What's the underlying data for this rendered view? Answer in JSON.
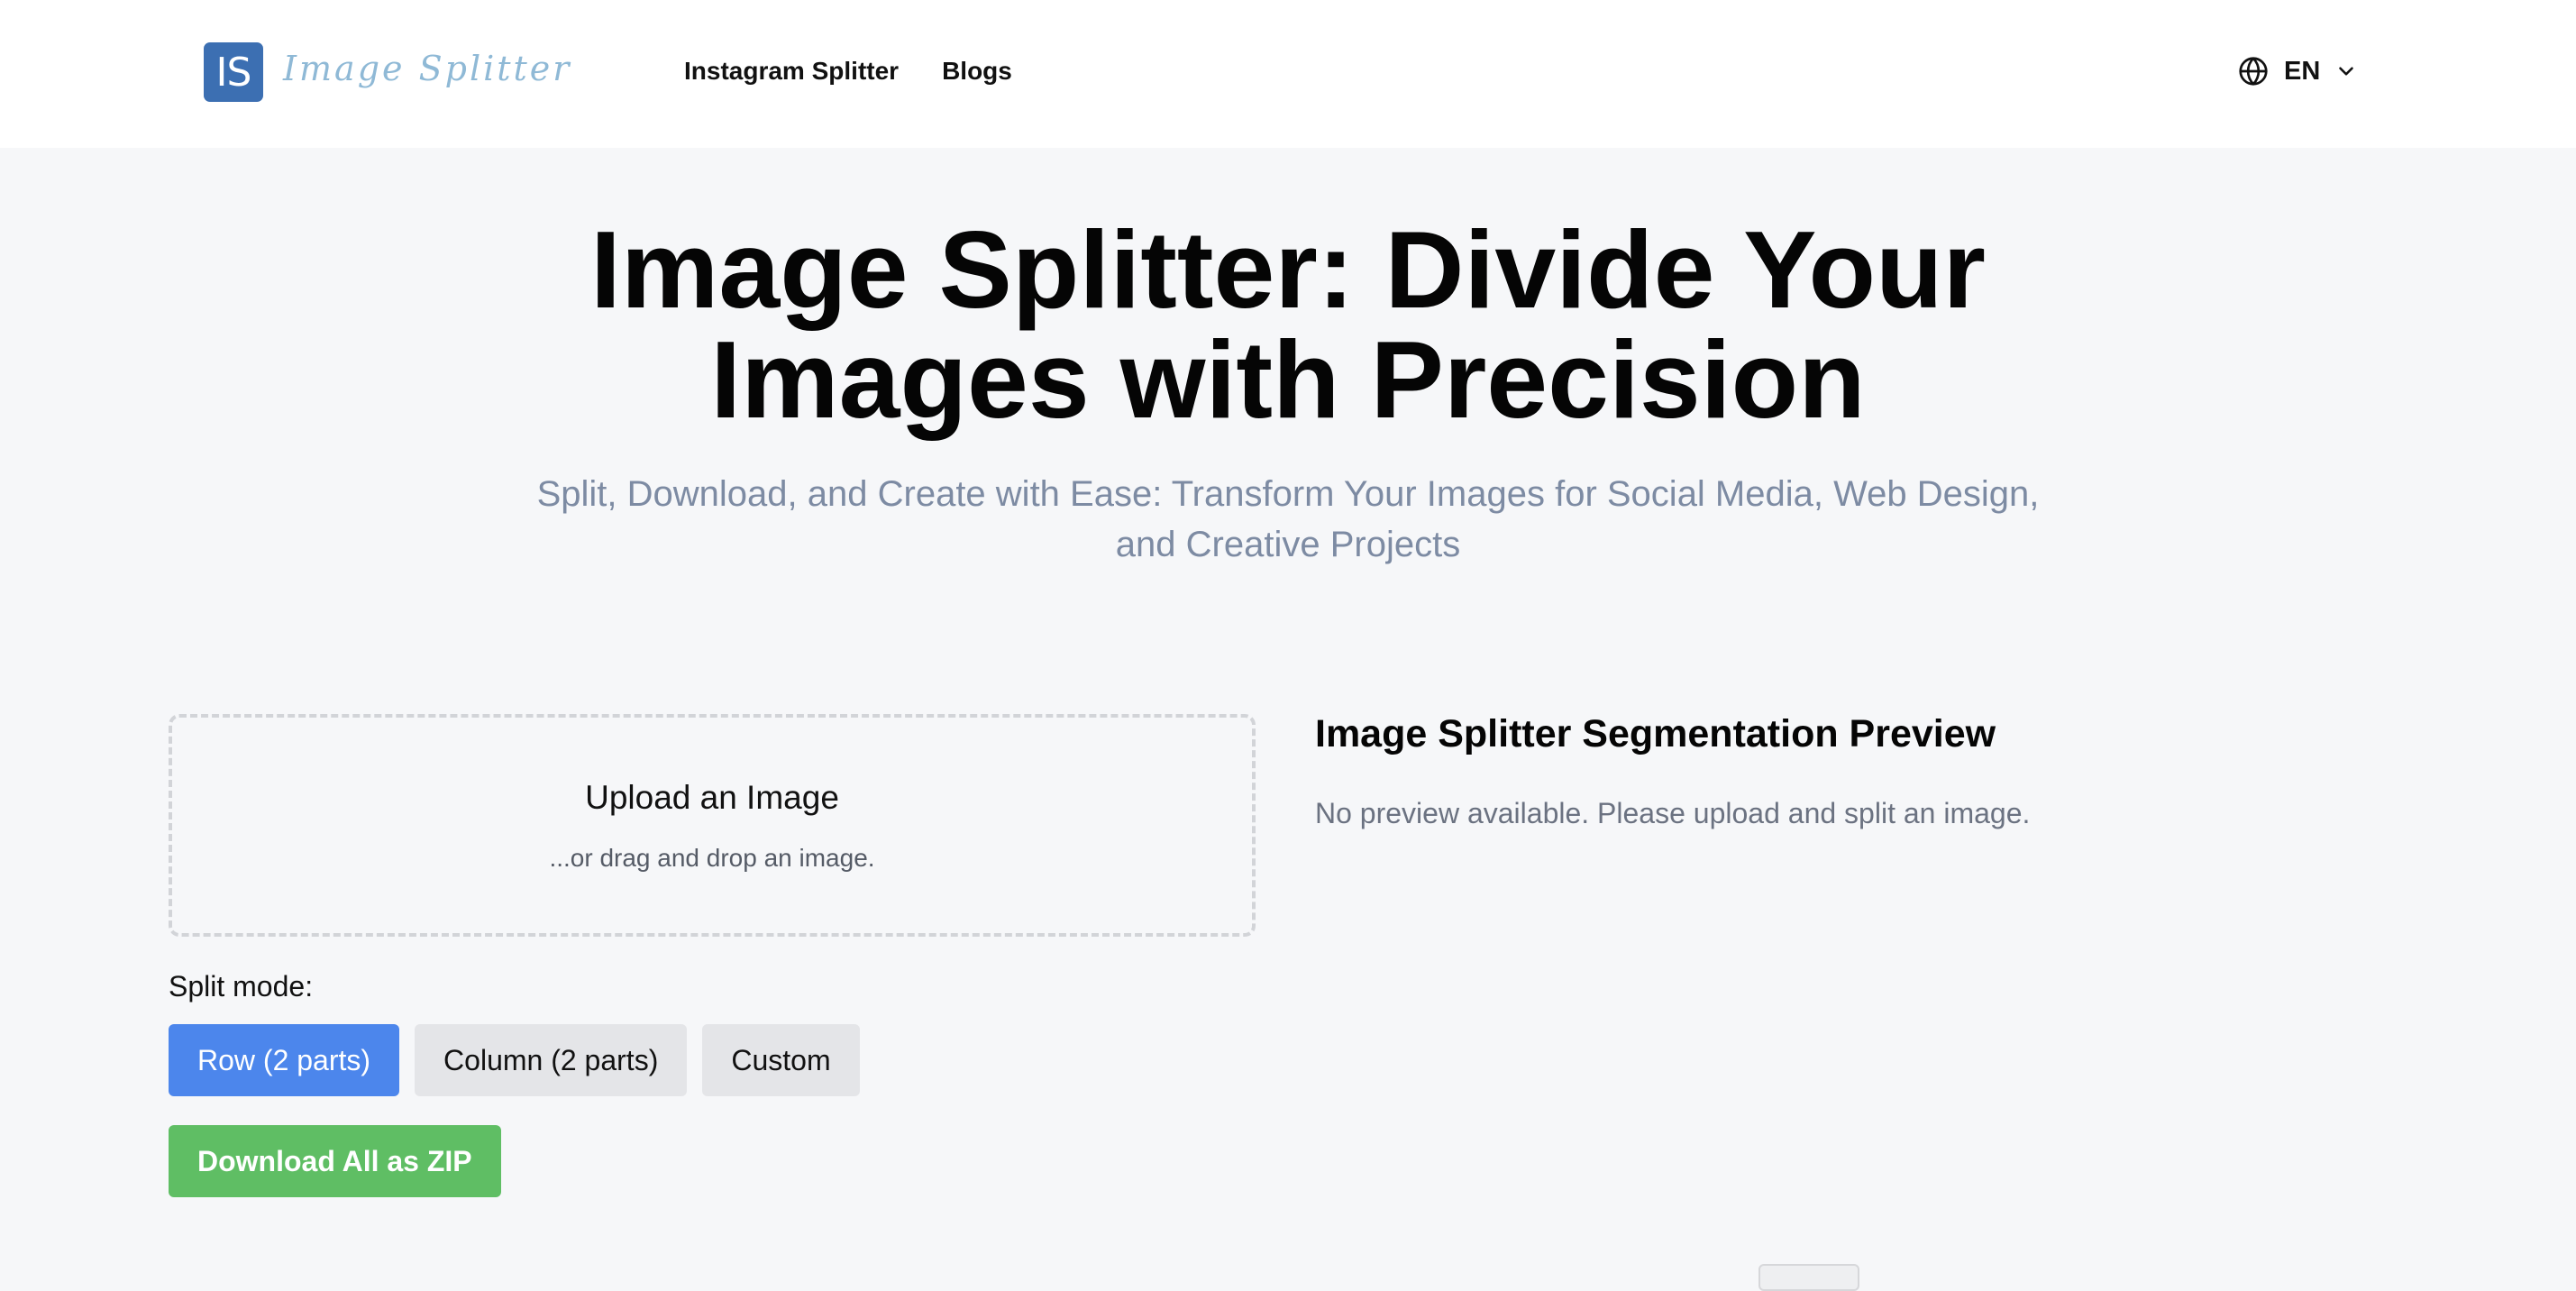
{
  "header": {
    "logo_mark": "IS",
    "logo_text": "Image Splitter",
    "nav": [
      {
        "label": "Instagram Splitter"
      },
      {
        "label": "Blogs"
      }
    ],
    "language": {
      "code": "EN",
      "icon": "globe-icon",
      "dropdown_icon": "chevron-down-icon"
    }
  },
  "hero": {
    "title_line1": "Image Splitter: Divide Your",
    "title_line2": "Images with Precision",
    "subtitle_line1": "Split, Download, and Create with Ease: Transform Your Images for Social Media, Web Design,",
    "subtitle_line2": "and Creative Projects"
  },
  "upload": {
    "title": "Upload an Image",
    "hint": "...or drag and drop an image."
  },
  "split_mode": {
    "label": "Split mode:",
    "options": [
      {
        "label": "Row (2 parts)",
        "selected": true
      },
      {
        "label": "Column (2 parts)",
        "selected": false
      },
      {
        "label": "Custom",
        "selected": false
      }
    ]
  },
  "download_zip_label": "Download All as ZIP",
  "preview": {
    "title": "Image Splitter Segmentation Preview",
    "empty_message": "No preview available. Please upload and split an image."
  },
  "colors": {
    "accent": "#4c86ec",
    "download": "#5fbe64",
    "logo": "#3c6fb2",
    "subtitle": "#7d8ba3",
    "page_bg": "#f6f7f9"
  }
}
